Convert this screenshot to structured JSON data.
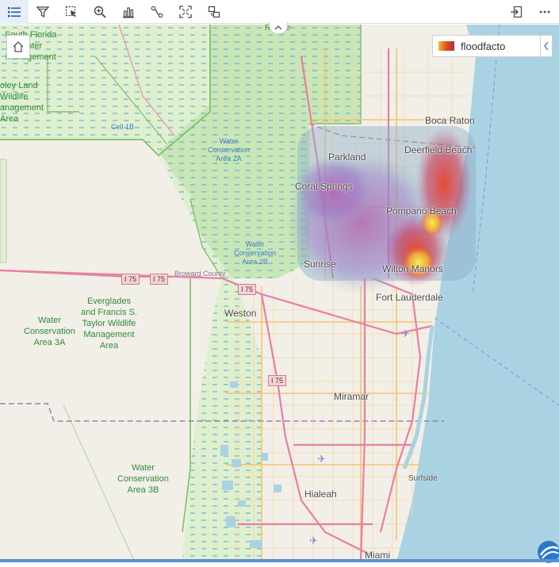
{
  "toolbar": {
    "buttons": [
      {
        "name": "layer-list-icon",
        "active": true
      },
      {
        "name": "filter-icon",
        "active": false
      },
      {
        "name": "select-icon",
        "active": false
      },
      {
        "name": "zoom-to-icon",
        "active": false
      },
      {
        "name": "chart-icon",
        "active": false
      },
      {
        "name": "route-icon",
        "active": false
      },
      {
        "name": "full-extent-icon",
        "active": false
      },
      {
        "name": "swap-icon",
        "active": false
      }
    ],
    "right_buttons": [
      {
        "name": "export-icon"
      },
      {
        "name": "more-options-icon"
      }
    ]
  },
  "legend": {
    "label": "floodfacto",
    "colors": [
      "#e8c23b",
      "#e64a1f",
      "#b0304a"
    ]
  },
  "map": {
    "cities": {
      "boca_raton": "Boca Raton",
      "deerfield_beach": "Deerfield Beach",
      "parkland": "Parkland",
      "coral_springs": "Coral Springs",
      "pompano_beach": "Pompano Beach",
      "sunrise": "Sunrise",
      "wilton_manors": "Wilton Manors",
      "fort_lauderdale": "Fort Lauderdale",
      "weston": "Weston",
      "miramar": "Miramar",
      "hialeah": "Hialeah",
      "miami": "Miami",
      "surfside": "Surfside"
    },
    "areas": {
      "south_florida_mgmt": "South Florida\nWater\nManagement",
      "loxahatchee": "oley Land\nWildlife\nanagement\nArea",
      "cell_1b": "Cell 1B",
      "wca_2a": "Water\nConservation\nArea 2A",
      "wca_2b": "Water\nConservation\nArea 2B",
      "wca_3a": "Water\nConservation\nArea 3A",
      "everglades": "Everglades\nand Francis S.\nTaylor Wildlife\nManagement\nArea",
      "wca_3b": "Water\nConservation\nArea 3B",
      "refuge": "Refuge"
    },
    "roads": {
      "broward_county": "Broward County",
      "i75_a": "I 75",
      "i75_b": "I 75",
      "i75_c": "I 75",
      "i75_d": "I 75"
    },
    "colors": {
      "ocean": "#a9d2e3",
      "land": "#f2efe9",
      "wetland": "#dff0cf",
      "conservation_fill": "#c9e7b6",
      "major_road": "#e87fa0",
      "arterial": "#f7c36b",
      "heat_low": "#9a78c8",
      "heat_mid": "#c94f8a",
      "heat_high": "#e8432a",
      "heat_peak": "#f4e53a"
    }
  }
}
